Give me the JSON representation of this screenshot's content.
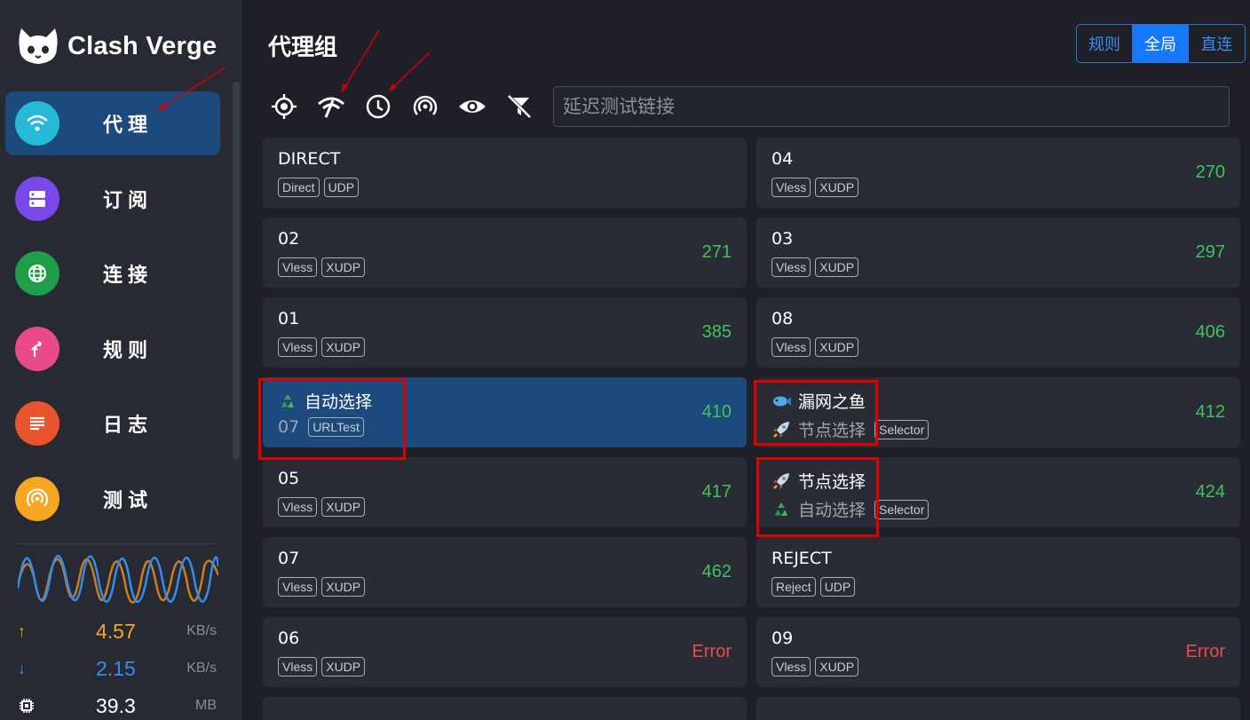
{
  "app": {
    "name": "Clash Verge"
  },
  "nav": [
    {
      "label": "代理",
      "icon": "wifi-icon",
      "color": "#26b9d8",
      "active": true
    },
    {
      "label": "订阅",
      "icon": "server-icon",
      "color": "#7a47e8",
      "active": false
    },
    {
      "label": "连接",
      "icon": "globe-icon",
      "color": "#1f9d4a",
      "active": false
    },
    {
      "label": "规则",
      "icon": "fork-icon",
      "color": "#e84a8a",
      "active": false
    },
    {
      "label": "日志",
      "icon": "lines-icon",
      "color": "#e8542d",
      "active": false
    },
    {
      "label": "测试",
      "icon": "signal-icon",
      "color": "#f5a623",
      "active": false
    }
  ],
  "stats": {
    "upload": {
      "value": "4.57",
      "unit": "KB/s",
      "color": "#f5a623"
    },
    "download": {
      "value": "2.15",
      "unit": "KB/s",
      "color": "#3d8bf2"
    },
    "memory": {
      "value": "39.3",
      "unit": "MB"
    }
  },
  "main": {
    "title": "代理组",
    "modes": [
      {
        "label": "规则",
        "active": false
      },
      {
        "label": "全局",
        "active": true
      },
      {
        "label": "直连",
        "active": false
      }
    ],
    "url_placeholder": "延迟测试链接"
  },
  "proxies": [
    {
      "name": "DIRECT",
      "tags": [
        "Direct",
        "UDP"
      ],
      "delay": ""
    },
    {
      "name": "04",
      "tags": [
        "Vless",
        "XUDP"
      ],
      "delay": "270"
    },
    {
      "name": "02",
      "tags": [
        "Vless",
        "XUDP"
      ],
      "delay": "271"
    },
    {
      "name": "03",
      "tags": [
        "Vless",
        "XUDP"
      ],
      "delay": "297"
    },
    {
      "name": "01",
      "tags": [
        "Vless",
        "XUDP"
      ],
      "delay": "385"
    },
    {
      "name": "08",
      "tags": [
        "Vless",
        "XUDP"
      ],
      "delay": "406"
    },
    {
      "name": "自动选择",
      "emoji": "recycle",
      "sub": "07",
      "tags": [
        "URLTest"
      ],
      "delay": "410",
      "active": true
    },
    {
      "name": "漏网之鱼",
      "emoji": "fish",
      "sub": "节点选择",
      "sub_emoji": "rocket",
      "tags": [
        "Selector"
      ],
      "delay": "412"
    },
    {
      "name": "05",
      "tags": [
        "Vless",
        "XUDP"
      ],
      "delay": "417"
    },
    {
      "name": "节点选择",
      "emoji": "rocket",
      "sub": "自动选择",
      "sub_emoji": "recycle",
      "tags": [
        "Selector"
      ],
      "delay": "424"
    },
    {
      "name": "07",
      "tags": [
        "Vless",
        "XUDP"
      ],
      "delay": "462"
    },
    {
      "name": "REJECT",
      "tags": [
        "Reject",
        "UDP"
      ],
      "delay": ""
    },
    {
      "name": "06",
      "tags": [
        "Vless",
        "XUDP"
      ],
      "delay": "Error"
    },
    {
      "name": "09",
      "tags": [
        "Vless",
        "XUDP"
      ],
      "delay": "Error"
    }
  ]
}
